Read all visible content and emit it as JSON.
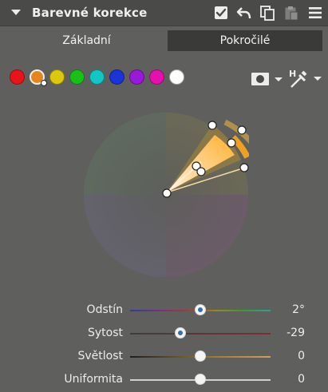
{
  "panel": {
    "title": "Barevné korekce",
    "enabled": true
  },
  "tabs": [
    {
      "label": "Základní",
      "active": false
    },
    {
      "label": "Pokročilé",
      "active": true
    }
  ],
  "swatches": [
    {
      "name": "red",
      "color": "#e8141a"
    },
    {
      "name": "orange",
      "color": "#e8841c",
      "selected": true
    },
    {
      "name": "yellow",
      "color": "#dcc80c"
    },
    {
      "name": "green",
      "color": "#18c018"
    },
    {
      "name": "cyan",
      "color": "#12c6c6"
    },
    {
      "name": "blue",
      "color": "#1a34d8"
    },
    {
      "name": "purple",
      "color": "#9a18d8"
    },
    {
      "name": "magenta",
      "color": "#e410b0"
    },
    {
      "name": "white",
      "color": "#ffffff"
    }
  ],
  "sliders": [
    {
      "label": "Odstín",
      "value": "2°",
      "position": 0.5,
      "track": "hue"
    },
    {
      "label": "Sytost",
      "value": "-29",
      "position": 0.36,
      "track": "saturation"
    },
    {
      "label": "Světlost",
      "value": "0",
      "position": 0.5,
      "track": "lightness"
    },
    {
      "label": "Uniformita",
      "value": "0",
      "position": 0.5,
      "track": "uniformity"
    }
  ],
  "icons": {
    "collapse": "collapse-arrow-icon",
    "enable": "checkbox-icon",
    "reset": "undo-icon",
    "copy": "copy-icon",
    "paste": "paste-icon",
    "menu": "hamburger-menu-icon",
    "mask": "mask-icon",
    "picker": "hue-picker-icon"
  }
}
